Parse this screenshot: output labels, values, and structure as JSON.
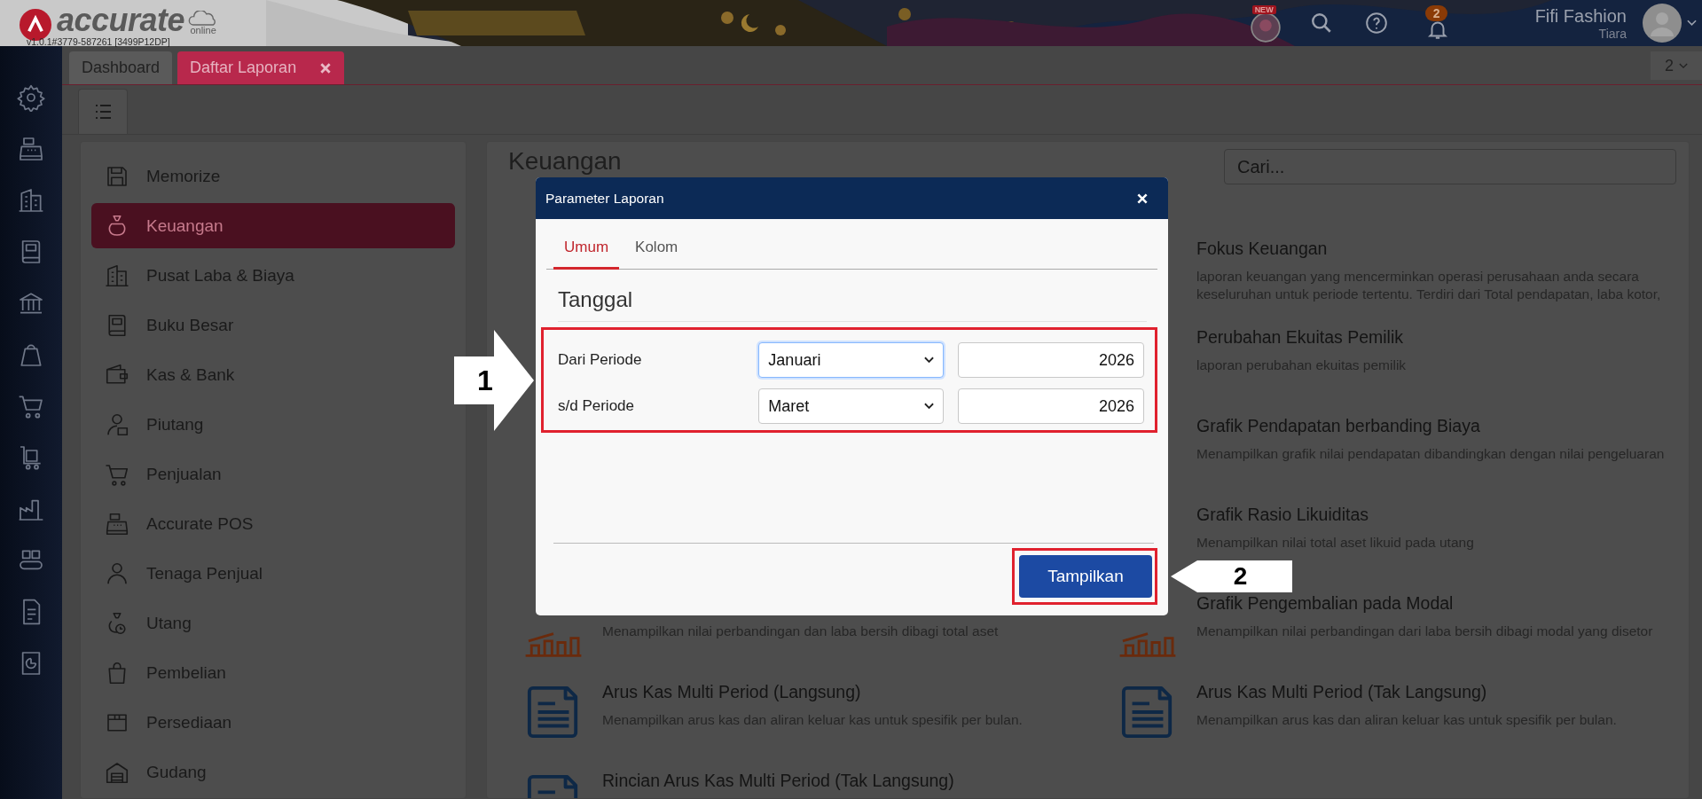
{
  "header": {
    "logo": "accurate",
    "logo_sub": "online",
    "version": "v1.0.1#3779-587261 [3499P12DP]",
    "new_badge": "NEW",
    "notification_count": "2",
    "user_name": "Fifi Fashion",
    "user_sub": "Tiara"
  },
  "tabs": [
    {
      "label": "Dashboard",
      "selected": false,
      "closable": false
    },
    {
      "label": "Daftar Laporan",
      "selected": true,
      "closable": true
    }
  ],
  "tab_count": "2",
  "menu": [
    {
      "label": "Memorize",
      "selected": false
    },
    {
      "label": "Keuangan",
      "selected": true
    },
    {
      "label": "Pusat Laba & Biaya",
      "selected": false
    },
    {
      "label": "Buku Besar",
      "selected": false
    },
    {
      "label": "Kas & Bank",
      "selected": false
    },
    {
      "label": "Piutang",
      "selected": false
    },
    {
      "label": "Penjualan",
      "selected": false
    },
    {
      "label": "Accurate POS",
      "selected": false
    },
    {
      "label": "Tenaga Penjual",
      "selected": false
    },
    {
      "label": "Utang",
      "selected": false
    },
    {
      "label": "Pembelian",
      "selected": false
    },
    {
      "label": "Persediaan",
      "selected": false
    },
    {
      "label": "Gudang",
      "selected": false
    }
  ],
  "content": {
    "title": "Keuangan",
    "search": {
      "placeholder": "Cari..."
    },
    "reports_left": [
      {
        "kind": "chart",
        "description": "Menampilkan nilai perbandingan dan laba bersih dibagi total aset"
      },
      {
        "kind": "document",
        "title": "Arus Kas Multi Period (Langsung)",
        "description": "Menampilkan arus kas dan aliran keluar kas untuk spesifik per bulan."
      },
      {
        "kind": "document",
        "title": "Rincian Arus Kas Multi Period (Tak Langsung)"
      }
    ],
    "reports_right": [
      {
        "title": "Fokus Keuangan",
        "description": "laporan keuangan yang mencerminkan operasi perusahaan anda secara keseluruhan untuk periode tertentu. Terdiri dari Total pendapatan, laba kotor,"
      },
      {
        "title": "Perubahan Ekuitas Pemilik",
        "description": "laporan perubahan ekuitas pemilik"
      },
      {
        "title": "Grafik Pendapatan berbanding Biaya",
        "description": "Menampilkan grafik nilai pendapatan dibandingkan dengan nilai pengeluaran"
      },
      {
        "title": "Grafik Rasio Likuiditas",
        "description": "Menampilkan nilai total aset likuid pada utang"
      },
      {
        "kind": "chart",
        "title": "Grafik Pengembalian pada Modal",
        "description": "Menampilkan nilai perbandingan dari laba bersih dibagi modal yang disetor"
      },
      {
        "kind": "document",
        "title": "Arus Kas Multi Period (Tak Langsung)",
        "description": "Menampilkan arus kas dan aliran keluar kas untuk spesifik per bulan."
      }
    ]
  },
  "dialog": {
    "title": "Parameter Laporan",
    "tabs": [
      {
        "label": "Umum",
        "selected": true
      },
      {
        "label": "Kolom",
        "selected": false
      }
    ],
    "section": "Tanggal",
    "rows": [
      {
        "label": "Dari Periode",
        "month": "Januari",
        "year": "2026",
        "focused": true
      },
      {
        "label": "s/d Periode",
        "month": "Maret",
        "year": "2026",
        "focused": false
      }
    ],
    "button": "Tampilkan"
  },
  "annotations": [
    {
      "number": "1",
      "kind": "right"
    },
    {
      "number": "2",
      "kind": "left"
    }
  ]
}
